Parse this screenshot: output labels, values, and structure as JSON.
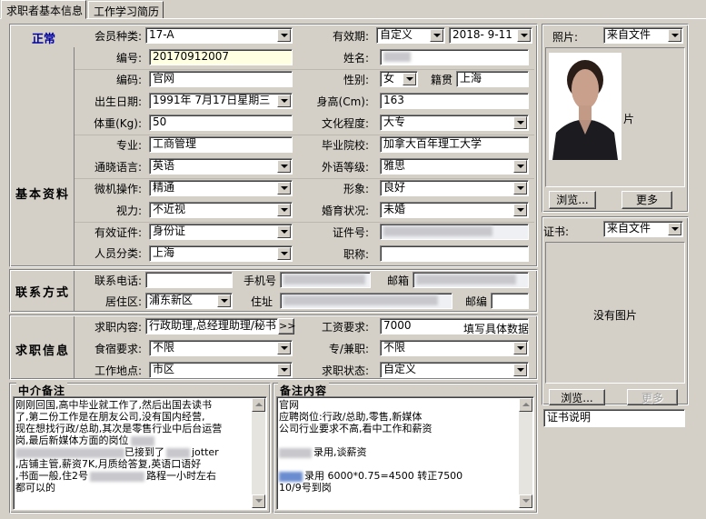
{
  "tabs": [
    "求职者基本信息",
    "工作学习简历"
  ],
  "status": "正常",
  "membership": {
    "label": "会员种类:",
    "value": "17-A"
  },
  "validity": {
    "label": "有效期:",
    "type": "自定义",
    "date": "2018- 9-11"
  },
  "photo": {
    "label": "照片:",
    "source": "来自文件",
    "partial_text": "片",
    "browse": "浏览...",
    "more": "更多"
  },
  "certificate": {
    "label": "证书:",
    "source": "来自文件",
    "empty": "没有图片",
    "browse": "浏览...",
    "more": "更多",
    "desc": "证书说明"
  },
  "basic": {
    "section": "基本资料",
    "id_label": "编号:",
    "id_value": "20170912007",
    "name_label": "姓名:",
    "code_label": "编码:",
    "code_value": "官网",
    "gender_label": "性别:",
    "gender_value": "女",
    "origin_label": "籍贯",
    "origin_value": "上海",
    "birth_label": "出生日期:",
    "birth_value": "1991年 7月17日星期三",
    "height_label": "身高(Cm):",
    "height_value": "163",
    "weight_label": "体重(Kg):",
    "weight_value": "50",
    "edu_label": "文化程度:",
    "edu_value": "大专",
    "major_label": "专业:",
    "major_value": "工商管理",
    "school_label": "毕业院校:",
    "school_value": "加拿大百年理工大学",
    "lang_label": "通晓语言:",
    "lang_value": "英语",
    "langlevel_label": "外语等级:",
    "langlevel_value": "雅思",
    "computer_label": "微机操作:",
    "computer_value": "精通",
    "image_label": "形象:",
    "image_value": "良好",
    "vision_label": "视力:",
    "vision_value": "不近视",
    "marital_label": "婚育状况:",
    "marital_value": "未婚",
    "doc_label": "有效证件:",
    "doc_value": "身份证",
    "certno_label": "证件号:",
    "category_label": "人员分类:",
    "category_value": "上海",
    "title_label": "职称:"
  },
  "contact": {
    "section": "联系方式",
    "phone_label": "联系电话:",
    "mobile_label": "手机号",
    "email_label": "邮箱",
    "district_label": "居住区:",
    "district_value": "浦东新区",
    "address_label": "住址",
    "zip_label": "邮编"
  },
  "job": {
    "section": "求职信息",
    "content_label": "求职内容:",
    "content_value": "行政助理,总经理助理/秘书",
    "more_btn": ">>",
    "salary_label": "工资要求:",
    "salary_value": "7000",
    "salary_hint": "填写具体数据",
    "board_label": "食宿要求:",
    "board_value": "不限",
    "fulltime_label": "专/兼职:",
    "fulltime_value": "不限",
    "location_label": "工作地点:",
    "location_value": "市区",
    "state_label": "求职状态:",
    "state_value": "自定义"
  },
  "agent_note": {
    "title": "中介备注",
    "lines": [
      "刚刚回国,高中毕业就工作了,然后出国去读书",
      "了,第二份工作是在朋友公司,没有国内经营,",
      "现在想找行政/总助,其次是零售行业中后台运营",
      "岗,最后新媒体方面的岗位",
      "已接到了",
      "jotter",
      ",店铺主管,薪资7K,月质给答复,英语口语好",
      ",书面一般,住2号",
      "路程一小时左右",
      "都可以的"
    ]
  },
  "remark": {
    "title": "备注内容",
    "lines": [
      "官网",
      "应聘岗位:行政/总助,零售,新媒体",
      "公司行业要求不高,看中工作和薪资",
      "",
      "录用,谈薪资",
      "",
      "录用 6000*0.75=4500  转正7500",
      "10/9号到岗"
    ]
  }
}
